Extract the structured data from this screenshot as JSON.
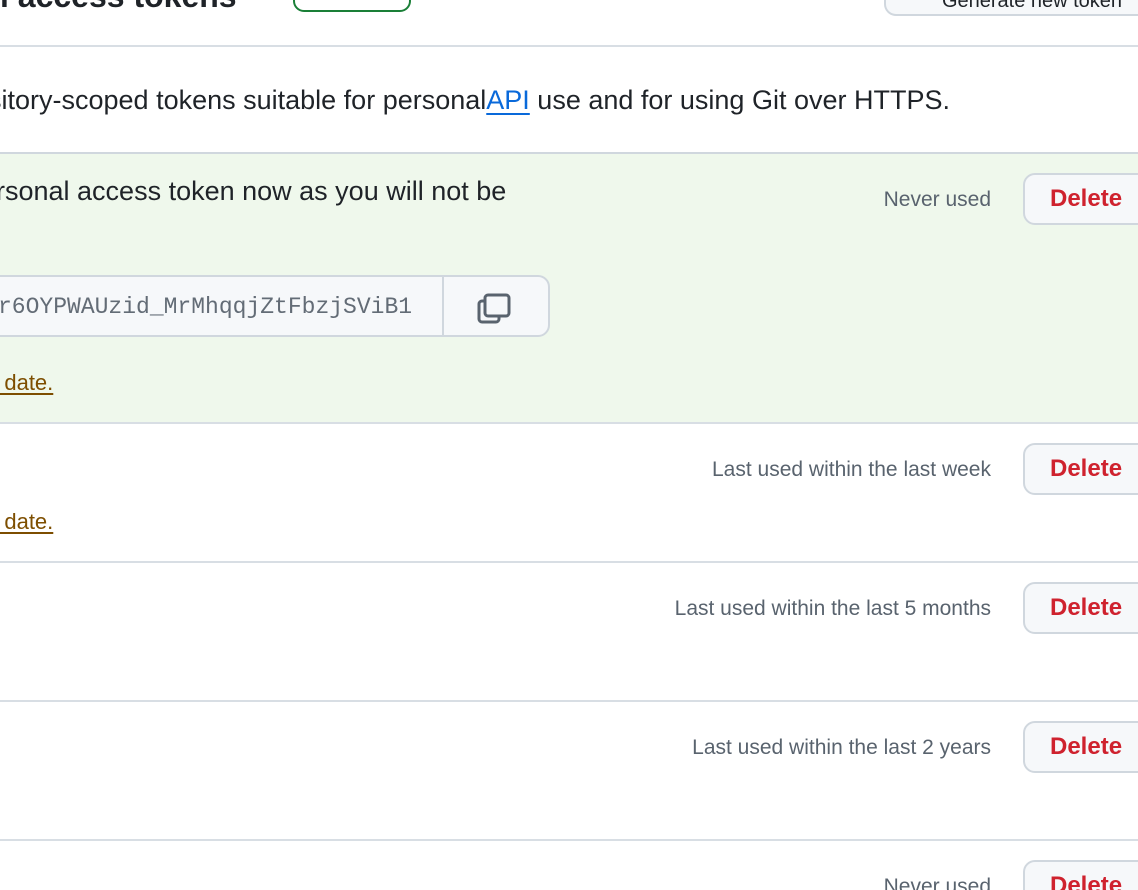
{
  "header": {
    "title": "l access tokens",
    "generate_label": "Generate new token"
  },
  "description": {
    "lead": "sitory-scoped tokens suitable for personal ",
    "link": "API",
    "tail": " use and for using Git over HTTPS."
  },
  "new_token": {
    "message": "rsonal access token now as you will not be",
    "token_value": "r6OYPWAUzid_MrMhqqjZtFbzjSViB1",
    "expiry_link": "n date.",
    "status": "Never used",
    "delete_label": "Delete"
  },
  "tokens": [
    {
      "status": "Last used within the last week",
      "delete_label": "Delete",
      "expiry_link": "n date."
    },
    {
      "status": "Last used within the last 5 months",
      "delete_label": "Delete"
    },
    {
      "status": "Last used within the last 2 years",
      "delete_label": "Delete"
    },
    {
      "status": "Never used",
      "delete_label": "Delete"
    }
  ],
  "icons": {
    "copy": "copy-icon"
  },
  "colors": {
    "danger": "#cf222e",
    "link": "#0969da",
    "warning": "#7d4e00",
    "new_bg": "#eff8ec",
    "beta_border": "#1a7f37"
  }
}
